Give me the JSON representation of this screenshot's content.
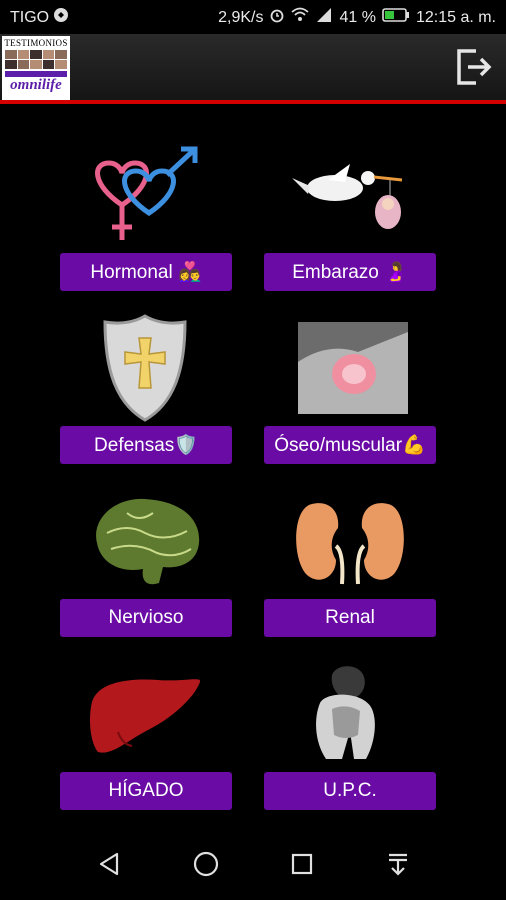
{
  "status_bar": {
    "carrier": "TIGO",
    "speed": "2,9K/s",
    "battery": "41 %",
    "time": "12:15 a. m."
  },
  "app_bar": {
    "logo_title": "TESTIMONIOS",
    "logo_brand": "omnilife",
    "exit_icon": "exit-icon"
  },
  "categories": [
    {
      "label": "Hormonal 👩‍❤️‍👨",
      "icon": "gender-symbols-icon"
    },
    {
      "label": "Embarazo 🤰",
      "icon": "stork-baby-icon"
    },
    {
      "label": "Defensas🛡️",
      "icon": "shield-cross-icon"
    },
    {
      "label": "Óseo/muscular💪",
      "icon": "knee-joint-icon"
    },
    {
      "label": "Nervioso",
      "icon": "brain-icon"
    },
    {
      "label": "Renal",
      "icon": "kidneys-icon"
    },
    {
      "label": "HÍGADO",
      "icon": "liver-icon"
    },
    {
      "label": "U.P.C.",
      "icon": "sitting-person-icon"
    }
  ],
  "nav_bar": {
    "items": [
      "back-icon",
      "home-icon",
      "recents-icon",
      "notification-pull-icon"
    ]
  },
  "colors": {
    "button_bg": "#6a0ba6",
    "accent_line": "#d40000",
    "background": "#000000"
  }
}
